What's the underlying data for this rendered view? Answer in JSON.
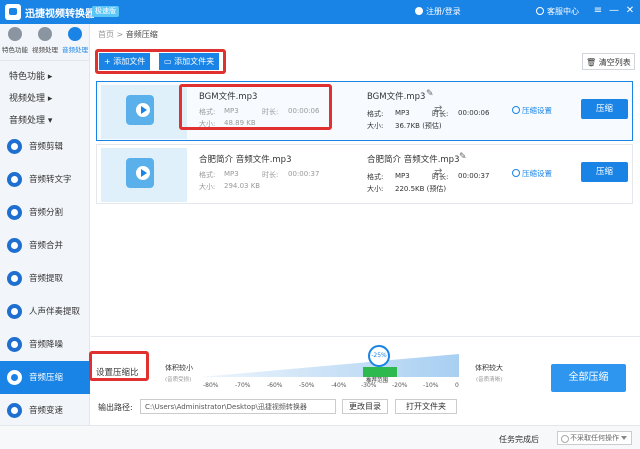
{
  "app": {
    "title": "迅捷视频转换器",
    "edition": "极速版",
    "login": "注册/登录",
    "support": "客服中心"
  },
  "window_controls": {
    "settings": "≡",
    "minimize": "—",
    "close": "✕"
  },
  "nav": {
    "tabs": [
      "特色功能",
      "视频处理",
      "音频处理"
    ]
  },
  "sidebar": {
    "categories": [
      "特色功能",
      "视频处理",
      "音频处理"
    ],
    "items": [
      "音频剪辑",
      "音频转文字",
      "音频分割",
      "音频合并",
      "音频提取",
      "人声伴奏提取",
      "音频降噪",
      "音频压缩",
      "音频变速"
    ]
  },
  "breadcrumb": {
    "home": "首页",
    "sep": ">",
    "current": "音频压缩"
  },
  "toolbar": {
    "add_file": "+ 添加文件",
    "add_folder": "添加文件夹",
    "clear_list": "清空列表"
  },
  "files": [
    {
      "name": "BGM文件.mp3",
      "format_label": "格式:",
      "format": "MP3",
      "duration_label": "时长:",
      "duration": "00:00:06",
      "size_label": "大小:",
      "size": "48.89 KB",
      "out_name": "BGM文件.mp3",
      "out_format": "MP3",
      "out_duration": "00:00:06",
      "out_size": "36.7KB (预估)",
      "settings": "压缩设置",
      "compress": "压缩"
    },
    {
      "name": "合肥简介 音频文件.mp3",
      "format_label": "格式:",
      "format": "MP3",
      "duration_label": "时长:",
      "duration": "00:00:37",
      "size_label": "大小:",
      "size": "294.03 KB",
      "out_name": "合肥简介 音频文件.mp3",
      "out_format": "MP3",
      "out_duration": "00:00:37",
      "out_size": "220.5KB (预估)",
      "settings": "压缩设置",
      "compress": "压缩"
    }
  ],
  "compression": {
    "label": "设置压缩比",
    "left_title": "体积较小",
    "left_sub": "(音质受损)",
    "right_title": "体积较大",
    "right_sub": "(音质清晰)",
    "ticks": [
      "-80%",
      "-70%",
      "-60%",
      "-50%",
      "-40%",
      "-30%",
      "-20%",
      "-10%",
      "0"
    ],
    "value": "-25%",
    "range_label": "推荐范围",
    "all_button": "全部压缩"
  },
  "output": {
    "label": "输出路径:",
    "path": "C:\\Users\\Administrator\\Desktop\\迅捷视频转换器",
    "change_dir": "更改目录",
    "open_folder": "打开文件夹"
  },
  "status": {
    "after_label": "任务完成后",
    "after_value": "不采取任何操作"
  },
  "colors": {
    "primary": "#1a84e6",
    "highlight": "#e0302f",
    "recommend": "#2db94d"
  }
}
